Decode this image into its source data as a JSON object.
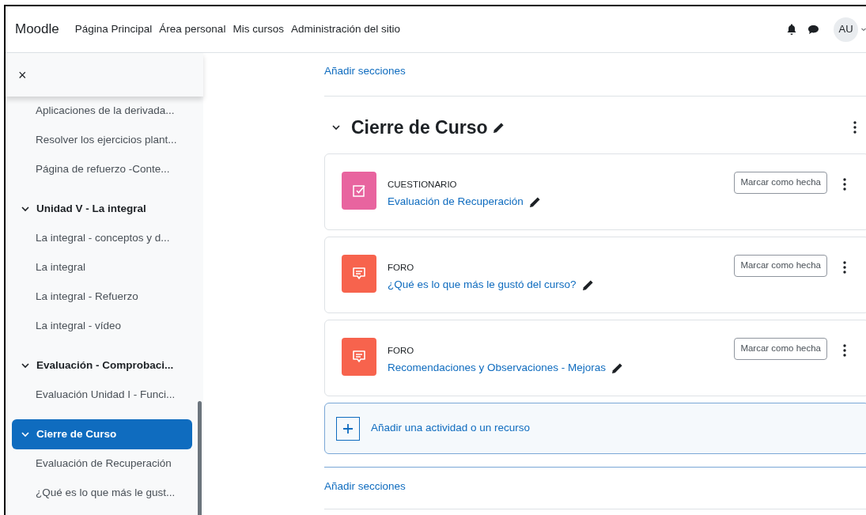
{
  "navbar": {
    "brand": "Moodle",
    "links": [
      "Página Principal",
      "Área personal",
      "Mis cursos",
      "Administración del sitio"
    ],
    "avatar": "AU"
  },
  "drawer": {
    "close": "×",
    "items": [
      {
        "kind": "activity",
        "label": "Aplicaciones de la derivada..."
      },
      {
        "kind": "activity",
        "label": "Resolver los ejercicios plant..."
      },
      {
        "kind": "activity",
        "label": "Página de refuerzo -Conte..."
      },
      {
        "kind": "section",
        "label": "Unidad V - La integral",
        "selected": false
      },
      {
        "kind": "activity",
        "label": "La integral - conceptos y d..."
      },
      {
        "kind": "activity",
        "label": "La integral"
      },
      {
        "kind": "activity",
        "label": "La integral - Refuerzo"
      },
      {
        "kind": "activity",
        "label": "La integral - vídeo"
      },
      {
        "kind": "section",
        "label": "Evaluación - Comprobaci...",
        "selected": false
      },
      {
        "kind": "activity",
        "label": "Evaluación Unidad I - Funci..."
      },
      {
        "kind": "section",
        "label": "Cierre de Curso",
        "selected": true
      },
      {
        "kind": "activity",
        "label": "Evaluación de Recuperación"
      },
      {
        "kind": "activity",
        "label": "¿Qué es lo que más le gust..."
      }
    ]
  },
  "main": {
    "top_link": "Añadir secciones",
    "section_title": "Cierre de Curso",
    "activities": [
      {
        "kind": "quiz",
        "type": "CUESTIONARIO",
        "name": "Evaluación de Recuperación",
        "button": "Marcar como hecha"
      },
      {
        "kind": "forum",
        "type": "FORO",
        "name": "¿Qué es lo que más le gustó del curso?",
        "button": "Marcar como hecha"
      },
      {
        "kind": "forum",
        "type": "FORO",
        "name": "Recomendaciones y Observaciones - Mejoras",
        "button": "Marcar como hecha"
      }
    ],
    "add_activity": "Añadir una actividad o un recurso",
    "bottom_link": "Añadir secciones"
  }
}
